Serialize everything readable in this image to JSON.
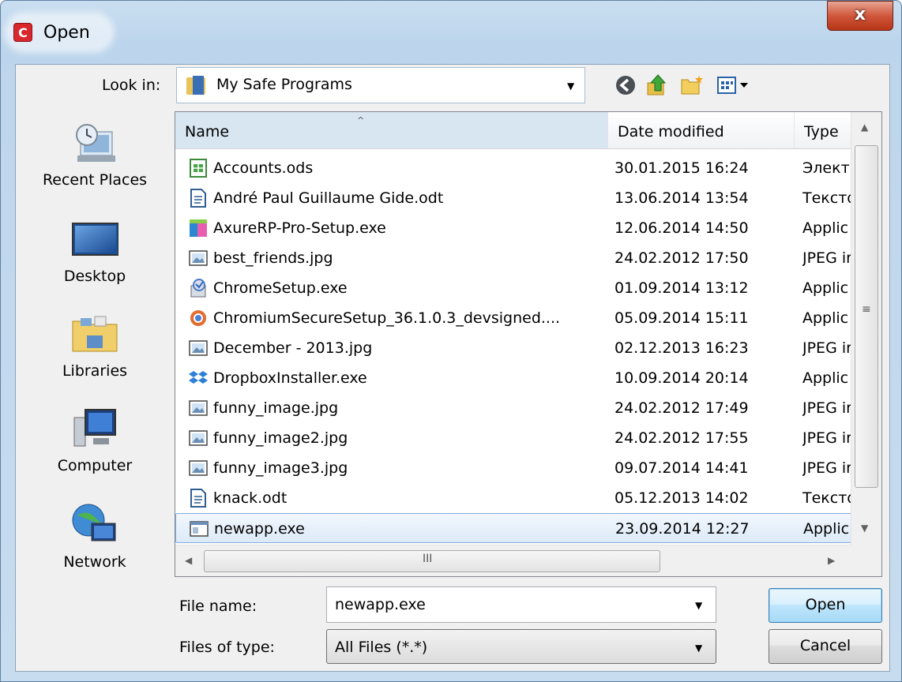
{
  "window": {
    "title": "Open",
    "app_icon_letter": "C",
    "close_symbol": "x"
  },
  "lookin": {
    "label": "Look in:",
    "value": "My Safe Programs",
    "dropdown_symbol": "▼"
  },
  "toolbar": {
    "items": [
      "back-icon",
      "up-folder-icon",
      "new-folder-icon",
      "view-menu-icon"
    ]
  },
  "sidebar": {
    "items": [
      {
        "label": "Recent Places",
        "icon": "recent-places-icon"
      },
      {
        "label": "Desktop",
        "icon": "desktop-icon"
      },
      {
        "label": "Libraries",
        "icon": "libraries-icon"
      },
      {
        "label": "Computer",
        "icon": "computer-icon"
      },
      {
        "label": "Network",
        "icon": "network-icon"
      }
    ]
  },
  "file_list": {
    "columns": [
      "Name",
      "Date modified",
      "Type"
    ],
    "sort_indicator": "^",
    "rows": [
      {
        "name": "Accounts.ods",
        "date": "30.01.2015 16:24",
        "type": "Электр",
        "icon": "spreadsheet-icon"
      },
      {
        "name": "André Paul Guillaume Gide.odt",
        "date": "13.06.2014 13:54",
        "type": "Тексто",
        "icon": "text-document-icon"
      },
      {
        "name": "AxureRP-Pro-Setup.exe",
        "date": "12.06.2014 14:50",
        "type": "Applic",
        "icon": "axure-installer-icon"
      },
      {
        "name": "best_friends.jpg",
        "date": "24.02.2012 17:50",
        "type": "JPEG ir",
        "icon": "image-file-icon"
      },
      {
        "name": "ChromeSetup.exe",
        "date": "01.09.2014 13:12",
        "type": "Applic",
        "icon": "installer-icon"
      },
      {
        "name": "ChromiumSecureSetup_36.1.0.3_devsigned....",
        "date": "05.09.2014 15:11",
        "type": "Applic",
        "icon": "chromium-icon"
      },
      {
        "name": "December - 2013.jpg",
        "date": "02.12.2013 16:23",
        "type": "JPEG ir",
        "icon": "image-file-icon"
      },
      {
        "name": "DropboxInstaller.exe",
        "date": "10.09.2014 20:14",
        "type": "Applic",
        "icon": "dropbox-icon"
      },
      {
        "name": "funny_image.jpg",
        "date": "24.02.2012 17:49",
        "type": "JPEG ir",
        "icon": "image-file-icon"
      },
      {
        "name": "funny_image2.jpg",
        "date": "24.02.2012 17:55",
        "type": "JPEG ir",
        "icon": "image-file-icon"
      },
      {
        "name": "funny_image3.jpg",
        "date": "09.07.2014 14:41",
        "type": "JPEG ir",
        "icon": "image-file-icon"
      },
      {
        "name": "knack.odt",
        "date": "05.12.2013 14:02",
        "type": "Тексто",
        "icon": "text-document-icon"
      },
      {
        "name": "newapp.exe",
        "date": "23.09.2014 12:27",
        "type": "Applic",
        "icon": "application-icon",
        "selected": true
      }
    ],
    "hscroll_grip": "III"
  },
  "filename": {
    "label": "File name:",
    "value": "newapp.exe"
  },
  "filetype": {
    "label": "Files of type:",
    "value": "All Files (*.*)"
  },
  "buttons": {
    "open": "Open",
    "cancel": "Cancel"
  }
}
